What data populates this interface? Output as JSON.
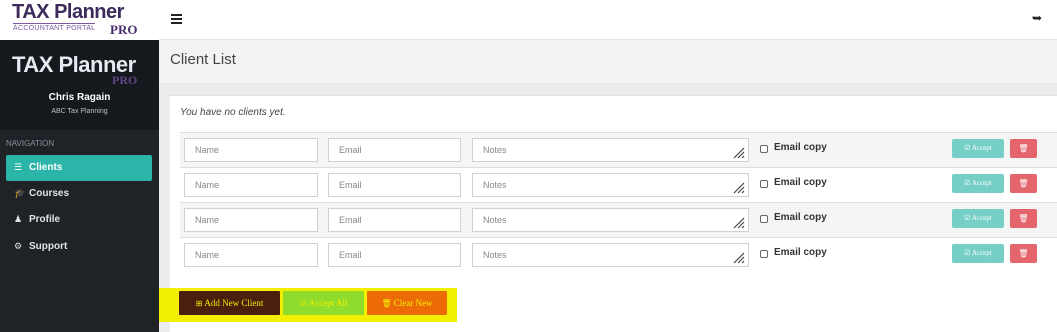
{
  "brand": {
    "title": "TAX Planner",
    "subtitle": "ACCOUNTANT PORTAL",
    "pro": "PRO"
  },
  "topbar": {
    "menu_icon": "hamburger-icon",
    "logout_icon": "sign-out-icon"
  },
  "sidebar": {
    "logo": "TAX Planner",
    "pro": "PRO",
    "user_name": "Chris Ragain",
    "company": "ABC Tax Planning",
    "nav_label": "NAVIGATION",
    "items": [
      {
        "label": "Clients",
        "icon": "list-icon",
        "active": true
      },
      {
        "label": "Courses",
        "icon": "graduation-cap-icon",
        "active": false
      },
      {
        "label": "Profile",
        "icon": "user-icon",
        "active": false
      },
      {
        "label": "Support",
        "icon": "lifebuoy-icon",
        "active": false
      }
    ]
  },
  "page": {
    "title": "Client List",
    "empty_message": "You have no clients yet."
  },
  "rows": [
    {
      "name_placeholder": "Name",
      "email_placeholder": "Email",
      "notes_placeholder": "Notes",
      "email_copy_label": "Email copy",
      "email_copy_checked": false,
      "accept_label": "Accept"
    },
    {
      "name_placeholder": "Name",
      "email_placeholder": "Email",
      "notes_placeholder": "Notes",
      "email_copy_label": "Email copy",
      "email_copy_checked": false,
      "accept_label": "Accept"
    },
    {
      "name_placeholder": "Name",
      "email_placeholder": "Email",
      "notes_placeholder": "Notes",
      "email_copy_label": "Email copy",
      "email_copy_checked": false,
      "accept_label": "Accept"
    },
    {
      "name_placeholder": "Name",
      "email_placeholder": "Email",
      "notes_placeholder": "Notes",
      "email_copy_label": "Email copy",
      "email_copy_checked": false,
      "accept_label": "Accept"
    }
  ],
  "actions": {
    "add_label": "Add New Client",
    "accept_all_label": "Accept All",
    "clear_label": "Clear New"
  },
  "colors": {
    "accent": "#2bb5a8",
    "accept": "#76cfc7",
    "delete": "#e4666c",
    "highlight": "#f2f000",
    "add_button": "#4a1f0e",
    "accept_all_button": "#8fdc2c",
    "clear_button": "#ec6b06"
  }
}
